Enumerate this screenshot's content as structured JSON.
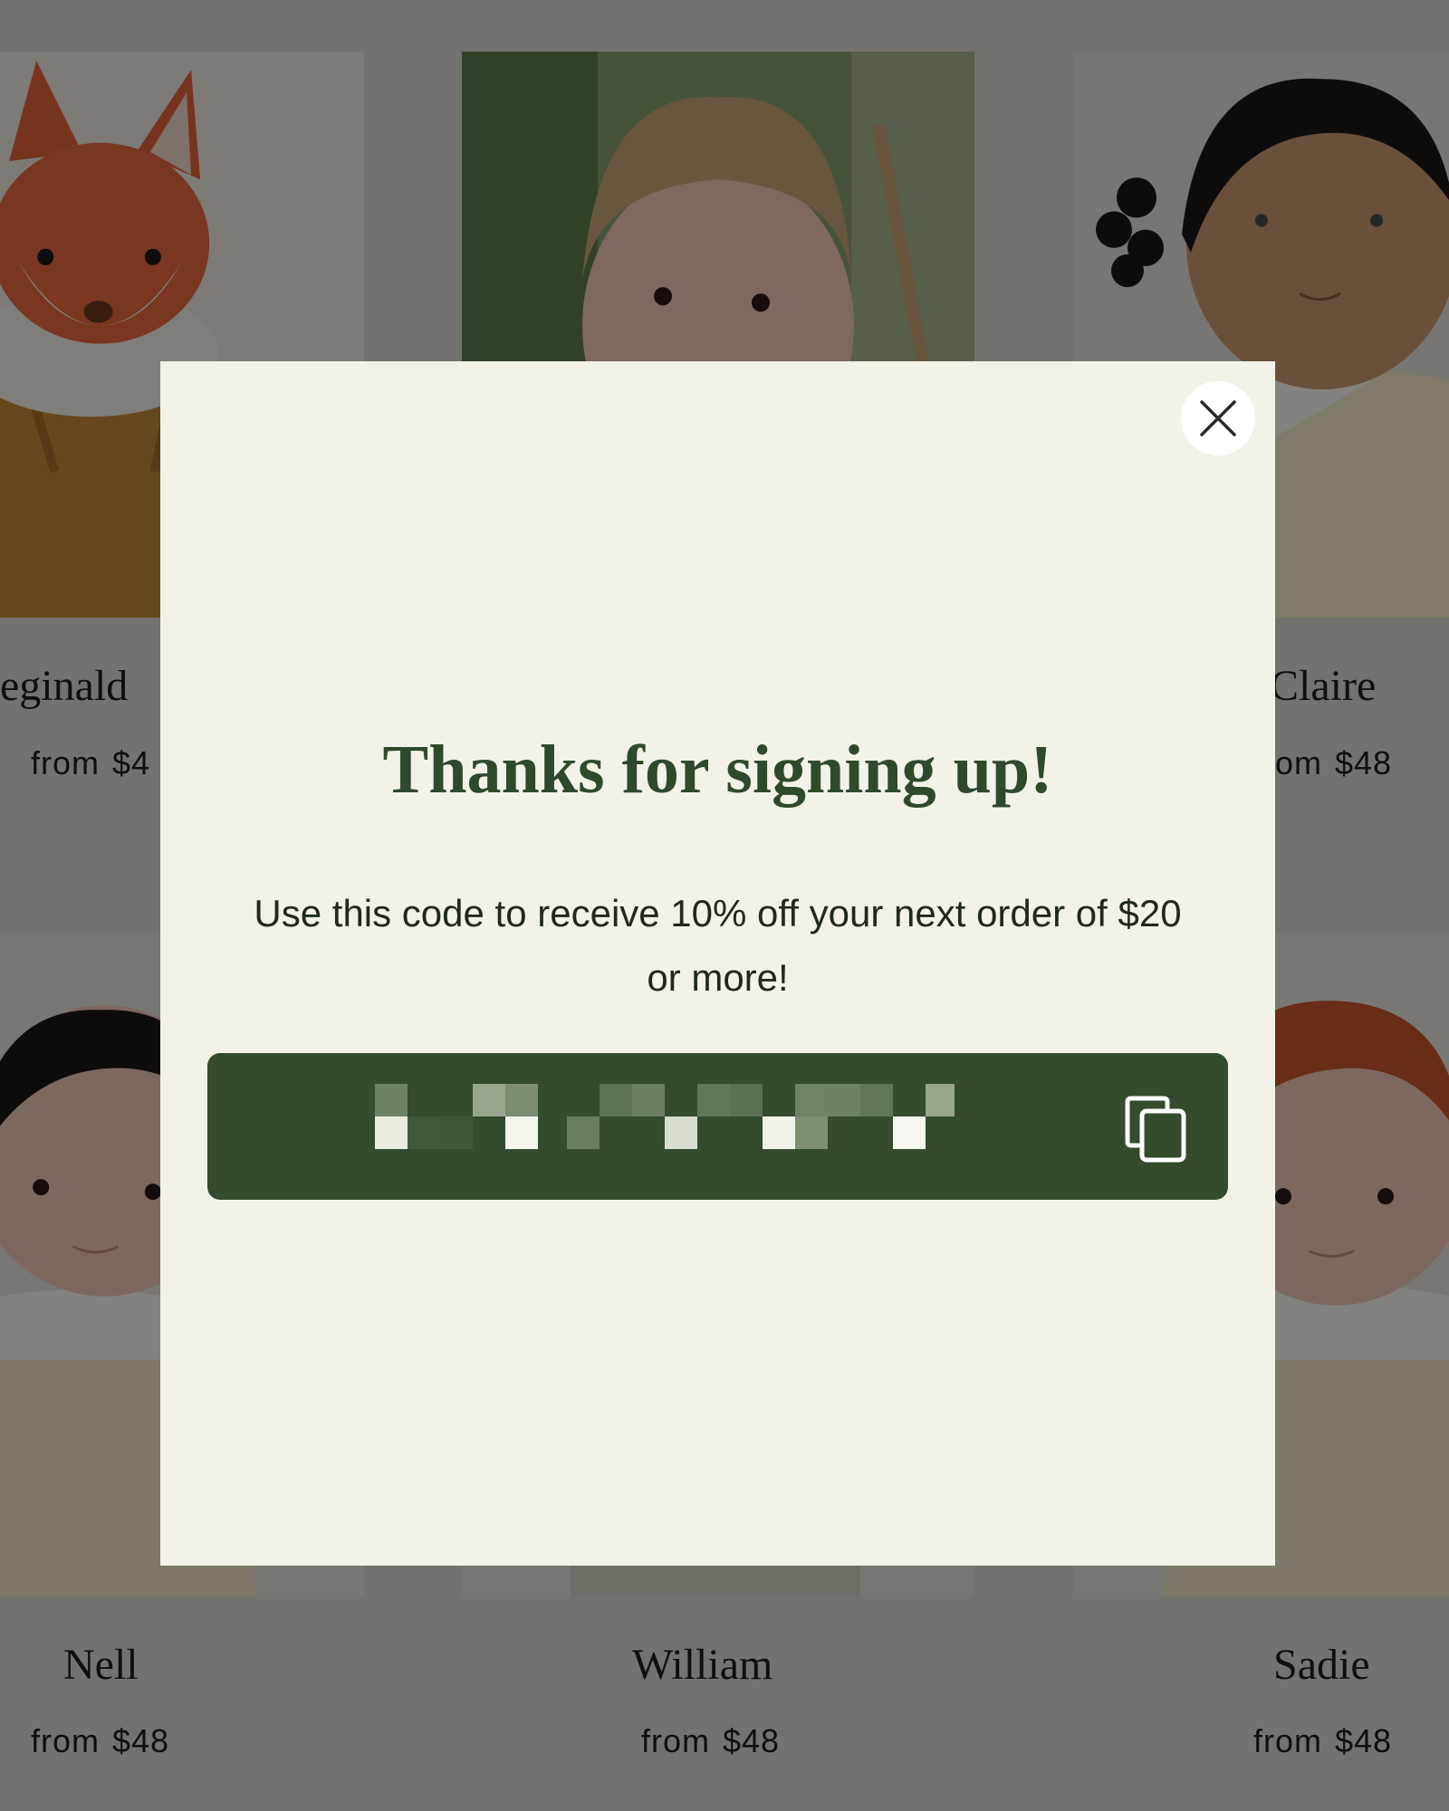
{
  "products": [
    {
      "name": "eginald",
      "price_prefix": "from",
      "price": "$4"
    },
    {
      "name": "",
      "price_prefix": "",
      "price": ""
    },
    {
      "name": "Claire",
      "price_prefix": "om",
      "price": "$48"
    },
    {
      "name": "Nell",
      "price_prefix": "from",
      "price": "$48"
    },
    {
      "name": "William",
      "price_prefix": "from",
      "price": "$48"
    },
    {
      "name": "Sadie",
      "price_prefix": "from",
      "price": "$48"
    }
  ],
  "modal": {
    "title": "Thanks for signing up!",
    "subtitle": "Use this code to receive 10% off your next order of $20 or more!",
    "discount_code": "",
    "code_obscured": true,
    "close_icon": "close-icon",
    "copy_icon": "copy-icon"
  },
  "colors": {
    "accent_green": "#344b2e",
    "modal_bg": "#f3f2e8",
    "title_green": "#2f4a2a"
  }
}
